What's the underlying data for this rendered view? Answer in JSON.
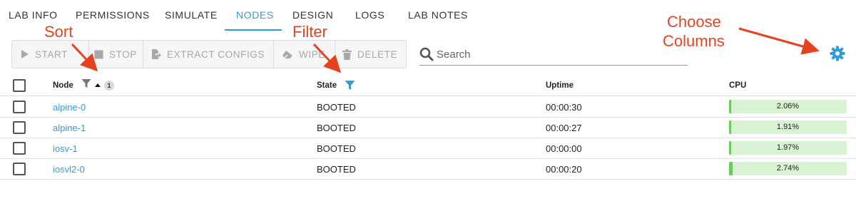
{
  "tabs": [
    {
      "label": "LAB INFO",
      "active": false
    },
    {
      "label": "PERMISSIONS",
      "active": false
    },
    {
      "label": "SIMULATE",
      "active": false
    },
    {
      "label": "NODES",
      "active": true
    },
    {
      "label": "DESIGN",
      "active": false
    },
    {
      "label": "LOGS",
      "active": false
    },
    {
      "label": "LAB NOTES",
      "active": false
    }
  ],
  "toolbar": {
    "start_label": "START",
    "stop_label": "STOP",
    "extract_label": "EXTRACT CONFIGS",
    "wipe_label": "WIPE",
    "delete_label": "DELETE"
  },
  "search": {
    "placeholder": "Search",
    "value": ""
  },
  "table": {
    "columns": {
      "node": "Node",
      "state": "State",
      "uptime": "Uptime",
      "cpu": "CPU"
    },
    "sort_badge": "1",
    "rows": [
      {
        "node": "alpine-0",
        "state": "BOOTED",
        "uptime": "00:00:30",
        "cpu": "2.06%",
        "cpu_fraction": 0.0206
      },
      {
        "node": "alpine-1",
        "state": "BOOTED",
        "uptime": "00:00:27",
        "cpu": "1.91%",
        "cpu_fraction": 0.0191
      },
      {
        "node": "iosv-1",
        "state": "BOOTED",
        "uptime": "00:00:00",
        "cpu": "1.97%",
        "cpu_fraction": 0.0197
      },
      {
        "node": "iosvl2-0",
        "state": "BOOTED",
        "uptime": "00:00:20",
        "cpu": "2.74%",
        "cpu_fraction": 0.0274
      }
    ]
  },
  "annotations": {
    "sort": "Sort",
    "filter": "Filter",
    "choose_line1": "Choose",
    "choose_line2": "Columns"
  },
  "colors": {
    "accent": "#2d9cdb",
    "link": "#3a9ad9",
    "annotation": "#e5431f",
    "cpu_bar_bg": "#d9f2d3",
    "cpu_bar_fill": "#6cc95a"
  },
  "icons": {
    "start": "play-icon",
    "stop": "stop-icon",
    "extract": "extract-icon",
    "wipe": "eraser-icon",
    "delete": "trash-icon",
    "search": "search-icon",
    "settings": "gear-icon",
    "filter": "filter-icon",
    "sort": "sort-up-icon"
  }
}
